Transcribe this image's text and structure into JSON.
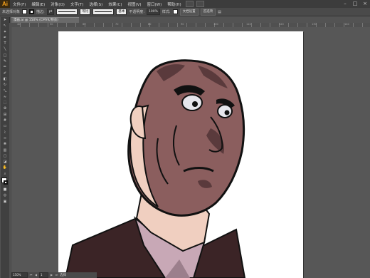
{
  "app": {
    "logo": "Ai"
  },
  "menu": [
    "文件(F)",
    "编辑(E)",
    "对象(O)",
    "文字(T)",
    "选择(S)",
    "效果(C)",
    "视图(V)",
    "窗口(W)",
    "帮助(H)"
  ],
  "control": {
    "selection_label": "未选择对象",
    "stroke_label": "描边:",
    "stroke_width": "pt",
    "line_style": "等比",
    "brush_style": "基本",
    "opacity_label": "不透明度:",
    "opacity_value": "100%",
    "style_label": "样式:",
    "doc_setup_button": "文档设置",
    "preferences_button": "首选项"
  },
  "document": {
    "tab_title": "漫画.ai @ 150% (CMYK/预览)"
  },
  "status": {
    "zoom": "150%",
    "page": "1",
    "tool_name": "选择"
  },
  "ruler_ticks": [
    "40",
    "50",
    "60",
    "70",
    "80",
    "90",
    "100",
    "110",
    "120",
    "130",
    "140"
  ],
  "colors": {
    "skin": "#8b5e5e",
    "skin_light": "#f0cfc0",
    "shadow": "#5a3a3c",
    "suit": "#3b2426",
    "shirt": "#c8a8b6",
    "outline": "#111111"
  },
  "tools": [
    "selection-tool",
    "direct-selection-tool",
    "magic-wand-tool",
    "pen-tool",
    "type-tool",
    "line-tool",
    "rectangle-tool",
    "paintbrush-tool",
    "pencil-tool",
    "blob-brush-tool",
    "eraser-tool",
    "rotate-tool",
    "scale-tool",
    "warp-tool",
    "free-transform-tool",
    "shape-builder-tool",
    "perspective-grid-tool",
    "mesh-tool",
    "gradient-tool",
    "eyedropper-tool",
    "blend-tool",
    "symbol-sprayer-tool",
    "column-graph-tool",
    "artboard-tool",
    "slice-tool",
    "hand-tool",
    "zoom-tool"
  ]
}
